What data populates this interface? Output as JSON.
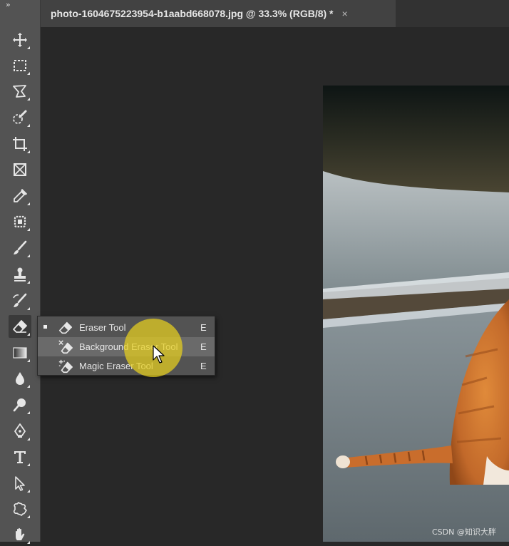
{
  "toolbar": {
    "collapse_glyph": "»",
    "tools": [
      "move",
      "rectangular-marquee",
      "polygonal-lasso",
      "quick-selection",
      "crop",
      "frame",
      "eyedropper",
      "spot-healing",
      "brush",
      "clone-stamp",
      "history-brush",
      "eraser",
      "gradient",
      "blur",
      "dodge",
      "pen",
      "type",
      "path-selection",
      "custom-shape",
      "hand"
    ],
    "active_tool": "eraser"
  },
  "document": {
    "tab_title": "photo-1604675223954-b1aabd668078.jpg @ 33.3% (RGB/8) *",
    "close_glyph": "×"
  },
  "flyout": {
    "items": [
      {
        "label": "Eraser Tool",
        "shortcut": "E",
        "selected": true
      },
      {
        "label": "Background Eraser Tool",
        "shortcut": "E",
        "hovered": true
      },
      {
        "label": "Magic Eraser Tool",
        "shortcut": "E"
      }
    ]
  },
  "watermark": "CSDN @知识大胖",
  "colors": {
    "toolbar_bg": "#535353",
    "canvas_bg": "#282828",
    "highlight": "#e8d01e"
  }
}
